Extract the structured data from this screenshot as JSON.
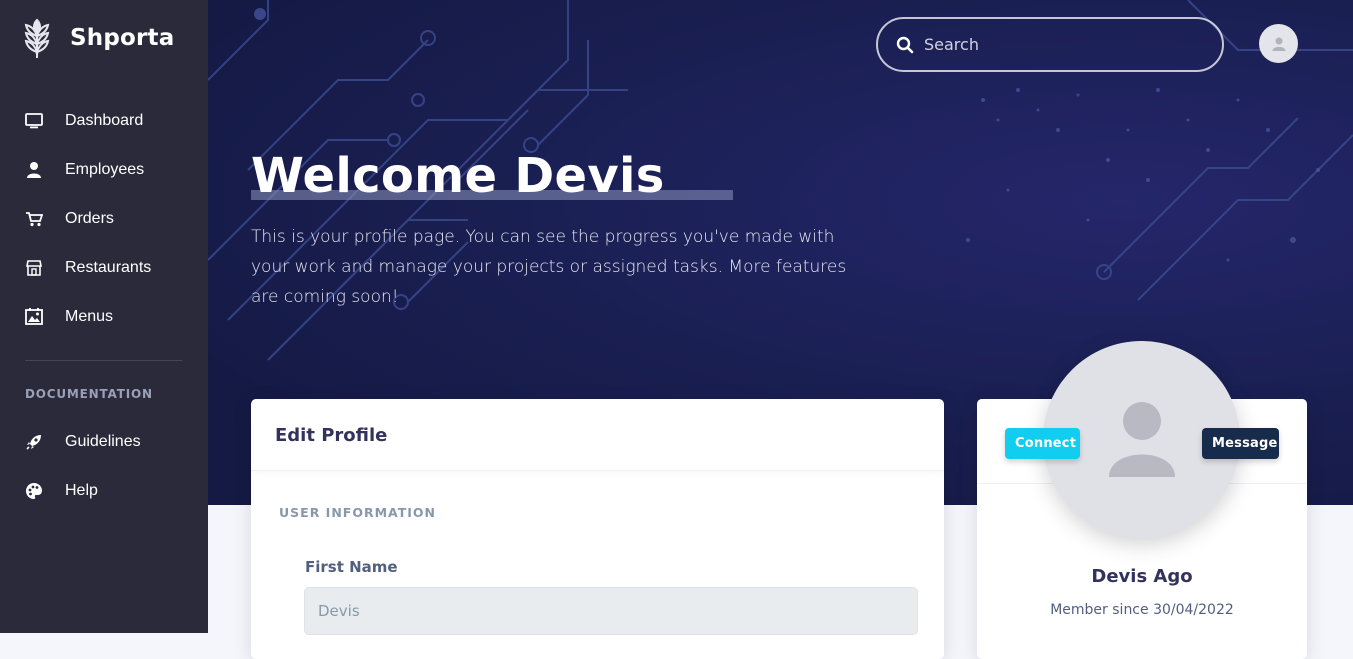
{
  "brand": {
    "name": "Shporta",
    "icon": "wheat-logo-icon"
  },
  "sidebar": {
    "items": [
      {
        "label": "Dashboard",
        "icon": "monitor-icon"
      },
      {
        "label": "Employees",
        "icon": "user-icon"
      },
      {
        "label": "Orders",
        "icon": "cart-icon"
      },
      {
        "label": "Restaurants",
        "icon": "store-icon"
      },
      {
        "label": "Menus",
        "icon": "image-icon"
      }
    ],
    "section_title": "DOCUMENTATION",
    "doc_items": [
      {
        "label": "Guidelines",
        "icon": "rocket-icon"
      },
      {
        "label": "Help",
        "icon": "palette-icon"
      }
    ]
  },
  "header": {
    "search_placeholder": "Search"
  },
  "hero": {
    "title": "Welcome Devis",
    "intro": "This is your profile page. You can see the progress you've made with your work and manage your projects or assigned tasks. More features are coming soon!"
  },
  "edit_profile": {
    "title": "Edit Profile",
    "section": "USER INFORMATION",
    "first_name_label": "First Name",
    "first_name_value": "Devis"
  },
  "profile_card": {
    "connect_label": "Connect",
    "message_label": "Message",
    "name": "Devis Ago",
    "member_since": "Member since 30/04/2022"
  },
  "colors": {
    "sidebar_bg": "#2a2a3a",
    "hero_bg": "#1c2158",
    "connect_btn": "#11cdef",
    "message_btn": "#172b4d"
  }
}
